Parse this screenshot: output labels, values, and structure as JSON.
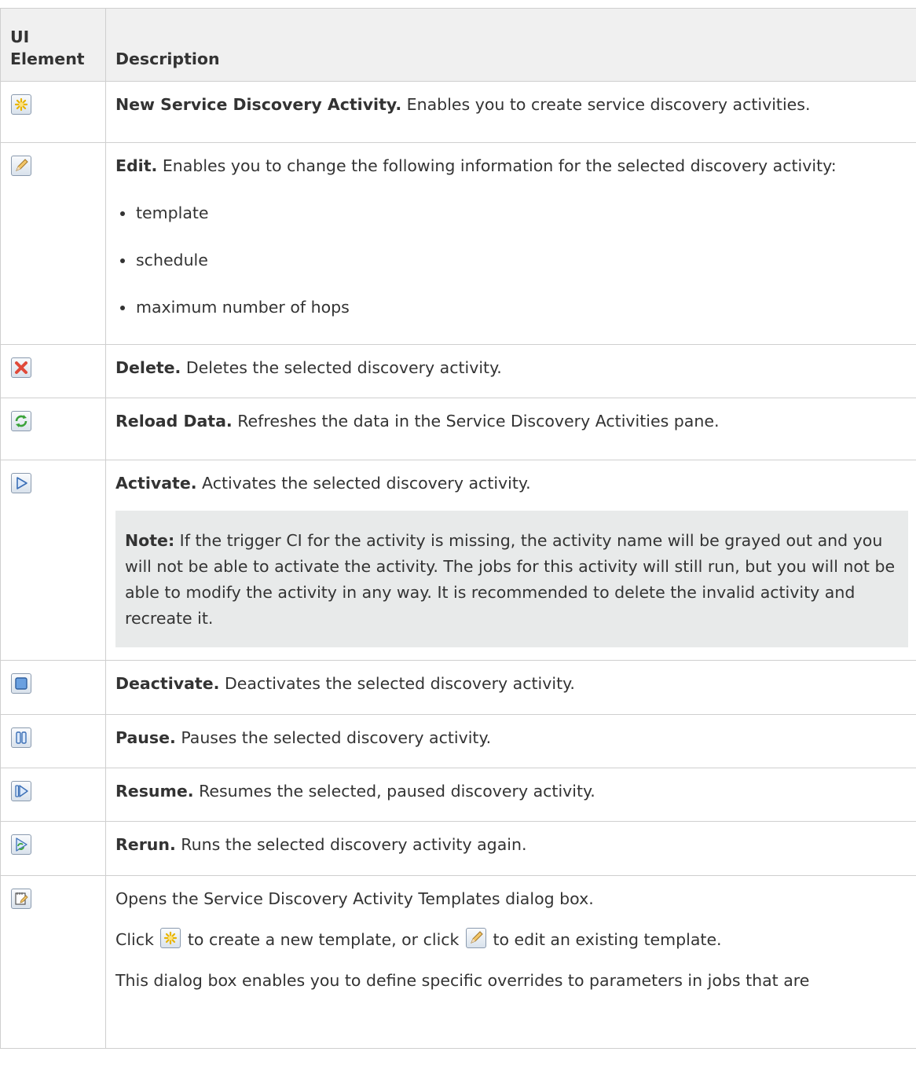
{
  "header": {
    "col1": "UI Element",
    "col2": "Description"
  },
  "rows": [
    {
      "icon": "new-star-icon",
      "title": "New Service Discovery Activity.",
      "text": " Enables you to create service discovery activities."
    },
    {
      "icon": "pencil-edit-icon",
      "title": "Edit.",
      "text": " Enables you to change the following information for the selected discovery activity:",
      "bullets": [
        "template",
        "schedule",
        "maximum number of hops"
      ]
    },
    {
      "icon": "delete-x-icon",
      "title": "Delete.",
      "text": " Deletes the selected discovery activity."
    },
    {
      "icon": "reload-icon",
      "title": "Reload Data.",
      "text": " Refreshes the data in the Service Discovery Activities pane."
    },
    {
      "icon": "play-icon",
      "title": "Activate.",
      "text": " Activates the selected discovery activity.",
      "note_label": "Note:",
      "note_text": " If the trigger CI for the activity is missing, the activity name will be grayed out and you will not be able to activate the activity. The jobs for this activity will still run, but you will not be able to modify the activity in any way. It is recommended to delete the invalid activity and recreate it."
    },
    {
      "icon": "stop-icon",
      "title": "Deactivate.",
      "text": " Deactivates the selected discovery activity."
    },
    {
      "icon": "pause-icon",
      "title": "Pause.",
      "text": " Pauses the selected discovery activity."
    },
    {
      "icon": "resume-icon",
      "title": "Resume.",
      "text": " Resumes the selected, paused discovery activity."
    },
    {
      "icon": "rerun-icon",
      "title": "Rerun.",
      "text": " Runs the selected discovery activity again."
    },
    {
      "icon": "templates-icon",
      "text": "Opens the Service Discovery Activity Templates dialog box.",
      "click_prefix": "Click ",
      "click_middle": " to create a new template, or click ",
      "click_suffix": " to edit an existing template.",
      "more_text": "This dialog box enables you to define specific overrides to parameters in jobs that are"
    }
  ]
}
